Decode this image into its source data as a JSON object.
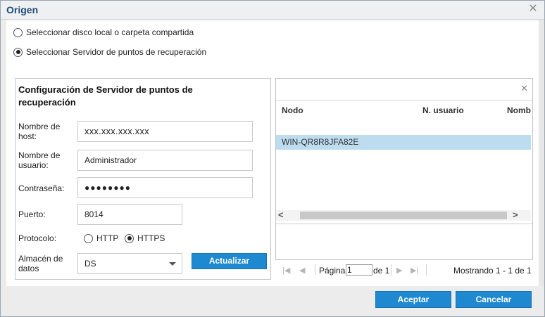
{
  "window": {
    "title": "Origen",
    "close_glyph": "✕"
  },
  "source_options": [
    {
      "label": "Seleccionar disco local o carpeta compartida",
      "selected": false
    },
    {
      "label": "Seleccionar Servidor de puntos de recuperación",
      "selected": true
    }
  ],
  "config": {
    "title": "Configuración de Servidor de puntos de recuperación",
    "host_label": "Nombre de host:",
    "host_value": "xxx.xxx.xxx.xxx",
    "user_label": "Nombre de usuario:",
    "user_value": "Administrador",
    "password_label": "Contraseña:",
    "password_value": "●●●●●●●●",
    "port_label": "Puerto:",
    "port_value": "8014",
    "protocol_label": "Protocolo:",
    "protocol_options": [
      {
        "label": "HTTP",
        "selected": false
      },
      {
        "label": "HTTPS",
        "selected": true
      }
    ],
    "store_label": "Almacén de datos",
    "store_value": "DS",
    "refresh_label": "Actualizar"
  },
  "grid": {
    "clear_glyph": "✕",
    "columns": [
      "Nodo",
      "N. usuario",
      "Nomb"
    ],
    "rows": [
      {
        "node": "WIN-QR8R8JFA82E",
        "selected": true
      }
    ],
    "scroll_left": "<",
    "scroll_right": ">"
  },
  "pager": {
    "page_label": "Página",
    "page_value": "1",
    "of_label": "de 1",
    "showing": "Mostrando 1 - 1 de 1"
  },
  "footer": {
    "accept_label": "Aceptar",
    "cancel_label": "Cancelar"
  },
  "colors": {
    "accent": "#1e88d0",
    "title": "#1f4e79",
    "selection": "#bddcf0"
  }
}
